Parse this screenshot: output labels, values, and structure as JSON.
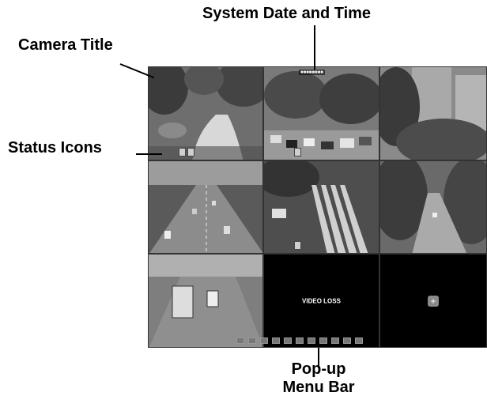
{
  "callouts": {
    "date_time": "System Date and Time",
    "camera_title": "Camera Title",
    "status_icons": "Status Icons",
    "menu_line1": "Pop-up",
    "menu_line2": "Menu Bar"
  },
  "screen": {
    "video_loss": "VIDEO LOSS",
    "add_symbol": "+"
  },
  "colors": {
    "grid_bg": "#000000",
    "callout_text": "#000000"
  }
}
